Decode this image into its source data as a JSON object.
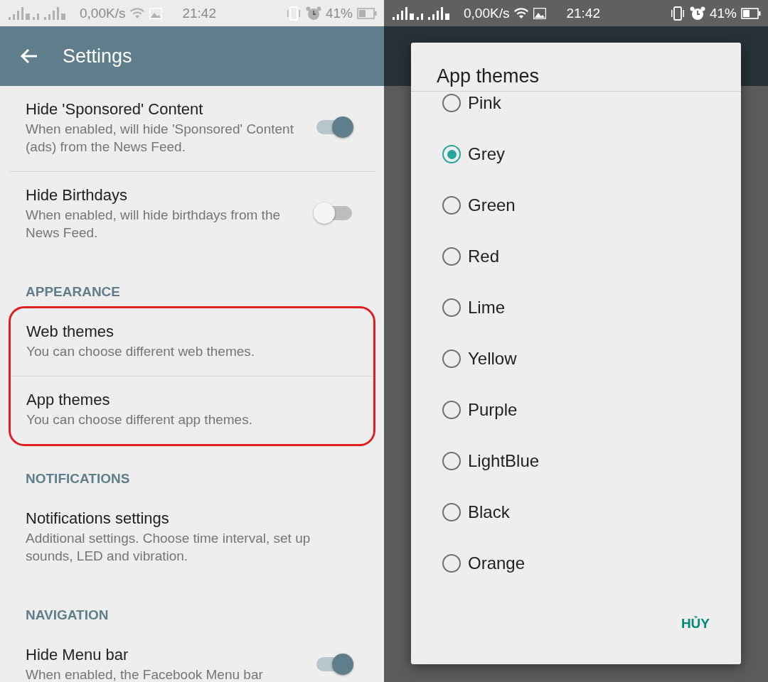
{
  "left_screen": {
    "status_bar": {
      "speed": "0,00K/s",
      "time": "21:42",
      "battery": "41%"
    },
    "app_bar": {
      "title": "Settings"
    },
    "sections": [
      {
        "items": [
          {
            "title": "Hide 'Sponsored' Content",
            "summary": "When enabled, will hide 'Sponsored' Content (ads) from the News Feed.",
            "kind": "toggle",
            "on": true
          },
          {
            "title": "Hide Birthdays",
            "summary": "When enabled, will hide birthdays from the News Feed.",
            "kind": "toggle",
            "on": false
          }
        ]
      },
      {
        "header": "APPEARANCE",
        "highlighted": true,
        "items": [
          {
            "title": "Web themes",
            "summary": "You can choose different web themes.",
            "kind": "link"
          },
          {
            "title": "App themes",
            "summary": "You can choose different app themes.",
            "kind": "link"
          }
        ]
      },
      {
        "header": "NOTIFICATIONS",
        "items": [
          {
            "title": "Notifications settings",
            "summary": "Additional settings. Choose time interval, set up sounds, LED and vibration.",
            "kind": "link"
          }
        ]
      },
      {
        "header": "NAVIGATION",
        "items": [
          {
            "title": "Hide Menu bar",
            "summary": "When enabled, the Facebook Menu bar",
            "kind": "toggle",
            "on": true
          }
        ]
      }
    ]
  },
  "right_screen": {
    "status_bar": {
      "speed": "0,00K/s",
      "time": "21:42",
      "battery": "41%"
    },
    "dialog": {
      "title": "App themes",
      "options": [
        {
          "label": "Pink",
          "selected": false
        },
        {
          "label": "Grey",
          "selected": true
        },
        {
          "label": "Green",
          "selected": false
        },
        {
          "label": "Red",
          "selected": false
        },
        {
          "label": "Lime",
          "selected": false
        },
        {
          "label": "Yellow",
          "selected": false
        },
        {
          "label": "Purple",
          "selected": false
        },
        {
          "label": "LightBlue",
          "selected": false
        },
        {
          "label": "Black",
          "selected": false
        },
        {
          "label": "Orange",
          "selected": false
        }
      ],
      "cancel": "HỦY"
    }
  }
}
